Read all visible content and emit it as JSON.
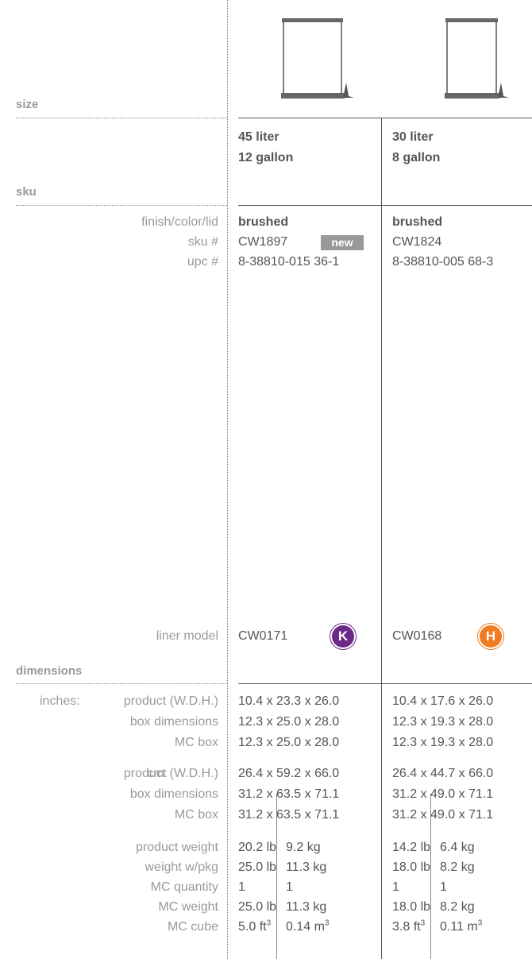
{
  "sections": {
    "size": "size",
    "sku": "sku",
    "dimensions": "dimensions"
  },
  "labels": {
    "finish": "finish/color/lid",
    "sku_num": "sku #",
    "upc_num": "upc #",
    "liner_model": "liner model",
    "inches_prefix": "inches:",
    "cm_prefix": "cm:",
    "product_whd": "product (W.D.H.)",
    "box_dimensions": "box dimensions",
    "mc_box": "MC box",
    "product_weight": "product weight",
    "weight_pkg": "weight w/pkg",
    "mc_quantity": "MC quantity",
    "mc_weight": "MC weight",
    "mc_cube": "MC cube"
  },
  "colors": {
    "liner_k": "#6b2a86",
    "liner_h": "#f07b22",
    "badge": "#999999"
  },
  "products": [
    {
      "icon": "trash-can-icon",
      "size_liter": "45 liter",
      "size_gallon": "12 gallon",
      "finish": "brushed",
      "sku": "CW1897",
      "badge": "new",
      "upc": "8-38810-015 36-1",
      "liner_model": "CW0171",
      "liner_letter": "K",
      "in_product": "10.4 x 23.3 x 26.0",
      "in_box": "12.3 x 25.0 x 28.0",
      "in_mc_box": "12.3 x 25.0 x 28.0",
      "cm_product": "26.4 x 59.2 x 66.0",
      "cm_box": "31.2 x 63.5 x 71.1",
      "cm_mc_box": "31.2 x 63.5 x 71.1",
      "product_weight_lb": "20.2 lb",
      "product_weight_kg": "9.2 kg",
      "weight_pkg_lb": "25.0 lb",
      "weight_pkg_kg": "11.3 kg",
      "mc_qty_1": "1",
      "mc_qty_2": "1",
      "mc_weight_lb": "25.0 lb",
      "mc_weight_kg": "11.3 kg",
      "mc_cube_ft": "5.0 ft",
      "mc_cube_m": "0.14 m",
      "sup": "3"
    },
    {
      "icon": "trash-can-icon",
      "size_liter": "30 liter",
      "size_gallon": "8 gallon",
      "finish": "brushed",
      "sku": "CW1824",
      "upc": "8-38810-005 68-3",
      "liner_model": "CW0168",
      "liner_letter": "H",
      "in_product": "10.4 x 17.6 x 26.0",
      "in_box": "12.3 x 19.3 x 28.0",
      "in_mc_box": "12.3 x 19.3 x 28.0",
      "cm_product": "26.4 x 44.7 x 66.0",
      "cm_box": "31.2 x 49.0 x 71.1",
      "cm_mc_box": "31.2 x 49.0 x 71.1",
      "product_weight_lb": "14.2 lb",
      "product_weight_kg": "6.4 kg",
      "weight_pkg_lb": "18.0 lb",
      "weight_pkg_kg": "8.2 kg",
      "mc_qty_1": "1",
      "mc_qty_2": "1",
      "mc_weight_lb": "18.0 lb",
      "mc_weight_kg": "8.2 kg",
      "mc_cube_ft": "3.8 ft",
      "mc_cube_m": "0.11 m",
      "sup": "3"
    }
  ]
}
